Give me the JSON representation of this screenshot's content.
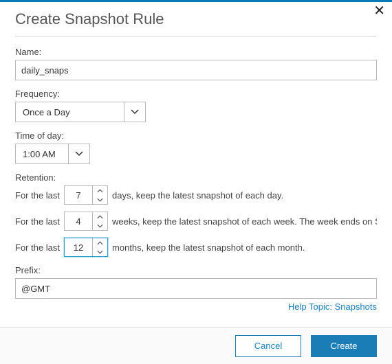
{
  "dialog": {
    "title": "Create Snapshot Rule",
    "close_icon": "close-icon"
  },
  "name": {
    "label": "Name:",
    "value": "daily_snaps"
  },
  "frequency": {
    "label": "Frequency:",
    "selected": "Once a Day"
  },
  "time_of_day": {
    "label": "Time of day:",
    "selected": "1:00 AM"
  },
  "retention": {
    "label": "Retention:",
    "rows": [
      {
        "prefix": "For the last",
        "value": "7",
        "suffix": "days, keep the latest snapshot of each day."
      },
      {
        "prefix": "For the last",
        "value": "4",
        "suffix": "weeks, keep the latest snapshot of each week. The week ends on Saturday."
      },
      {
        "prefix": "For the last",
        "value": "12",
        "suffix": "months, keep the latest snapshot of each month."
      }
    ]
  },
  "prefix_field": {
    "label": "Prefix:",
    "value": "@GMT"
  },
  "help": {
    "label": "Help Topic: Snapshots"
  },
  "footer": {
    "cancel": "Cancel",
    "create": "Create"
  }
}
